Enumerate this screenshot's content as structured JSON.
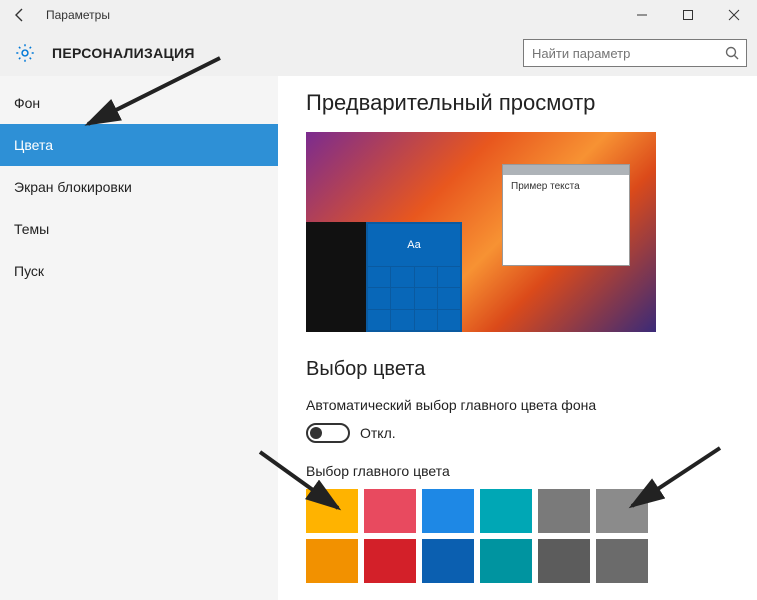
{
  "window": {
    "title": "Параметры"
  },
  "header": {
    "section": "ПЕРСОНАЛИЗАЦИЯ",
    "search_placeholder": "Найти параметр"
  },
  "sidebar": {
    "items": [
      {
        "label": "Фон",
        "selected": false
      },
      {
        "label": "Цвета",
        "selected": true
      },
      {
        "label": "Экран блокировки",
        "selected": false
      },
      {
        "label": "Темы",
        "selected": false
      },
      {
        "label": "Пуск",
        "selected": false
      }
    ]
  },
  "content": {
    "preview_title": "Предварительный просмотр",
    "sample_text": "Пример текста",
    "sample_tile_text": "Aa",
    "choose_color_title": "Выбор цвета",
    "auto_color_label": "Автоматический выбор главного цвета фона",
    "toggle_state": "Откл.",
    "main_color_label": "Выбор главного цвета",
    "colors_row1": [
      "#ffb300",
      "#e84a5f",
      "#1e88e5",
      "#00a7b5",
      "#7a7a7a",
      "#8b8b8b"
    ],
    "colors_row2": [
      "#f29100",
      "#d32029",
      "#0b5fb0",
      "#0094a0",
      "#5c5c5c",
      "#6b6b6b"
    ]
  }
}
